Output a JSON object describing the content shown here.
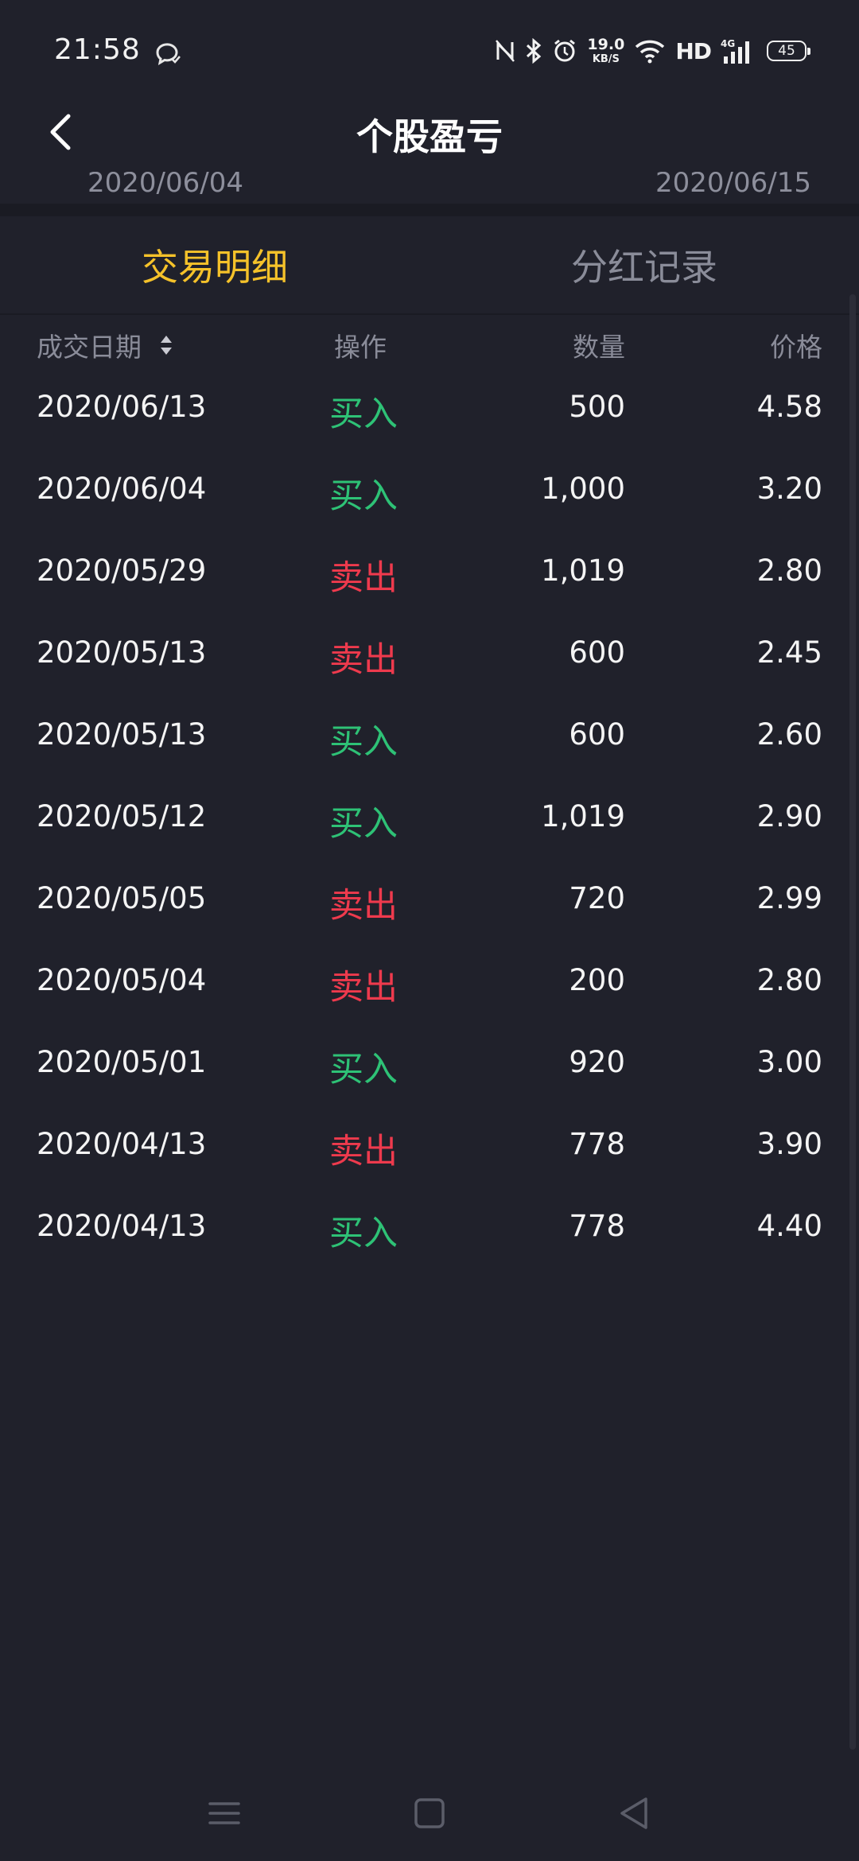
{
  "status_bar": {
    "time": "21:58",
    "net_speed_value": "19.0",
    "net_speed_unit": "KB/S",
    "network_label": "HD",
    "signal_label": "4G",
    "battery": "45"
  },
  "header": {
    "title": "个股盈亏"
  },
  "date_range": {
    "start": "2020/06/04",
    "end": "2020/06/15"
  },
  "tabs": [
    {
      "label": "交易明细",
      "active": true
    },
    {
      "label": "分红记录",
      "active": false
    }
  ],
  "table": {
    "columns": [
      "成交日期",
      "操作",
      "数量",
      "价格"
    ],
    "rows": [
      {
        "date": "2020/06/13",
        "op": "买入",
        "type": "buy",
        "qty": "500",
        "price": "4.58"
      },
      {
        "date": "2020/06/04",
        "op": "买入",
        "type": "buy",
        "qty": "1,000",
        "price": "3.20"
      },
      {
        "date": "2020/05/29",
        "op": "卖出",
        "type": "sell",
        "qty": "1,019",
        "price": "2.80"
      },
      {
        "date": "2020/05/13",
        "op": "卖出",
        "type": "sell",
        "qty": "600",
        "price": "2.45"
      },
      {
        "date": "2020/05/13",
        "op": "买入",
        "type": "buy",
        "qty": "600",
        "price": "2.60"
      },
      {
        "date": "2020/05/12",
        "op": "买入",
        "type": "buy",
        "qty": "1,019",
        "price": "2.90"
      },
      {
        "date": "2020/05/05",
        "op": "卖出",
        "type": "sell",
        "qty": "720",
        "price": "2.99"
      },
      {
        "date": "2020/05/04",
        "op": "卖出",
        "type": "sell",
        "qty": "200",
        "price": "2.80"
      },
      {
        "date": "2020/05/01",
        "op": "买入",
        "type": "buy",
        "qty": "920",
        "price": "3.00"
      },
      {
        "date": "2020/04/13",
        "op": "卖出",
        "type": "sell",
        "qty": "778",
        "price": "3.90"
      },
      {
        "date": "2020/04/13",
        "op": "买入",
        "type": "buy",
        "qty": "778",
        "price": "4.40"
      }
    ]
  },
  "colors": {
    "background": "#20212b",
    "active_tab": "#f5c22a",
    "buy": "#2ec276",
    "sell": "#ee3a4d",
    "muted_text": "#8a8c99"
  },
  "icons": {
    "back": "chevron-left-icon",
    "sort": "sort-icon",
    "nav_menu": "menu-icon",
    "nav_home": "home-square-icon",
    "nav_back": "back-triangle-icon"
  }
}
